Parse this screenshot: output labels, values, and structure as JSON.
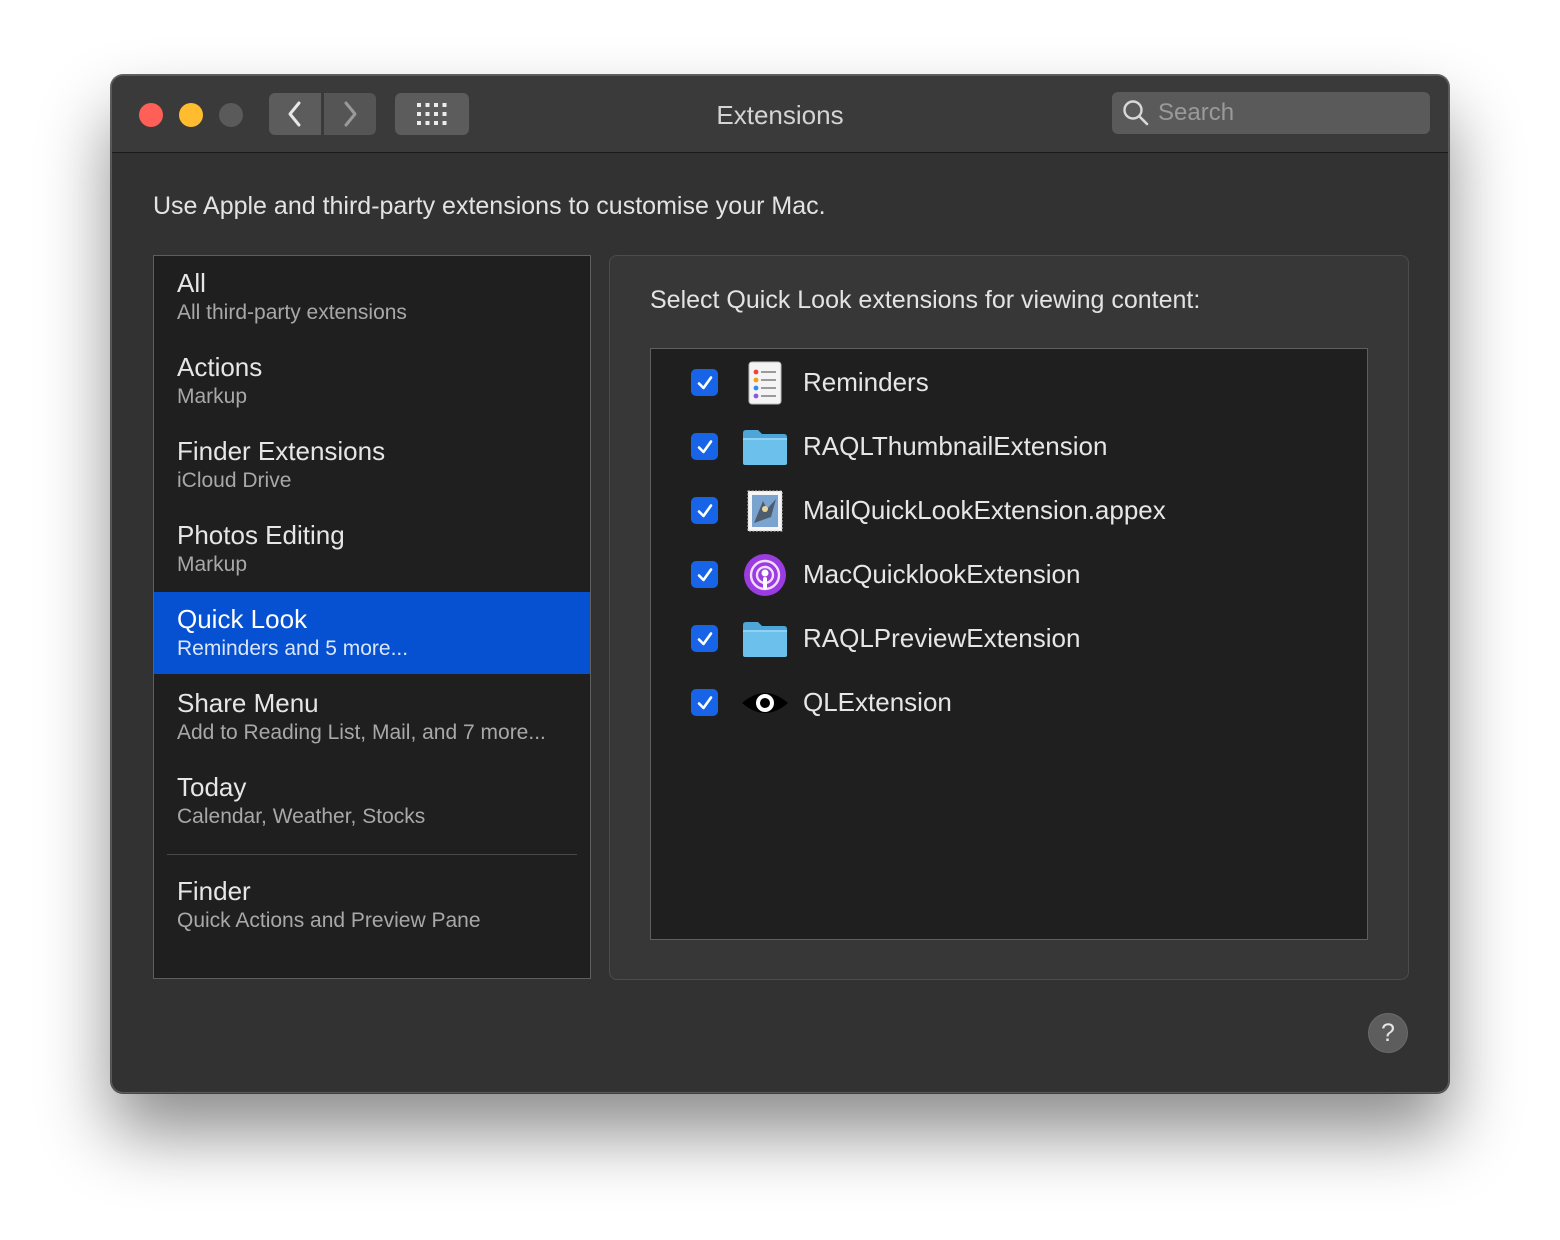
{
  "window": {
    "title": "Extensions",
    "search_placeholder": "Search",
    "intro": "Use Apple and third-party extensions to customise your Mac."
  },
  "sidebar": {
    "items": [
      {
        "name": "All",
        "sub": "All third-party extensions",
        "selected": false
      },
      {
        "name": "Actions",
        "sub": "Markup",
        "selected": false
      },
      {
        "name": "Finder Extensions",
        "sub": "iCloud Drive",
        "selected": false
      },
      {
        "name": "Photos Editing",
        "sub": "Markup",
        "selected": false
      },
      {
        "name": "Quick Look",
        "sub": "Reminders and 5 more...",
        "selected": true
      },
      {
        "name": "Share Menu",
        "sub": "Add to Reading List, Mail, and 7 more...",
        "selected": false
      },
      {
        "name": "Today",
        "sub": "Calendar, Weather, Stocks",
        "selected": false
      },
      {
        "name": "Finder",
        "sub": "Quick Actions and Preview Pane",
        "selected": false
      }
    ]
  },
  "panel": {
    "heading": "Select Quick Look extensions for viewing content:",
    "extensions": [
      {
        "label": "Reminders",
        "checked": true,
        "icon": "reminders-icon"
      },
      {
        "label": "RAQLThumbnailExtension",
        "checked": true,
        "icon": "folder-icon"
      },
      {
        "label": "MailQuickLookExtension.appex",
        "checked": true,
        "icon": "mail-stamp-icon"
      },
      {
        "label": "MacQuicklookExtension",
        "checked": true,
        "icon": "podcasts-icon"
      },
      {
        "label": "RAQLPreviewExtension",
        "checked": true,
        "icon": "folder-icon"
      },
      {
        "label": "QLExtension",
        "checked": true,
        "icon": "eye-icon"
      }
    ]
  },
  "help_label": "?",
  "colors": {
    "selection": "#0551d1",
    "checkbox": "#1764e8",
    "close": "#fe5f57",
    "minimize": "#febc2e"
  }
}
